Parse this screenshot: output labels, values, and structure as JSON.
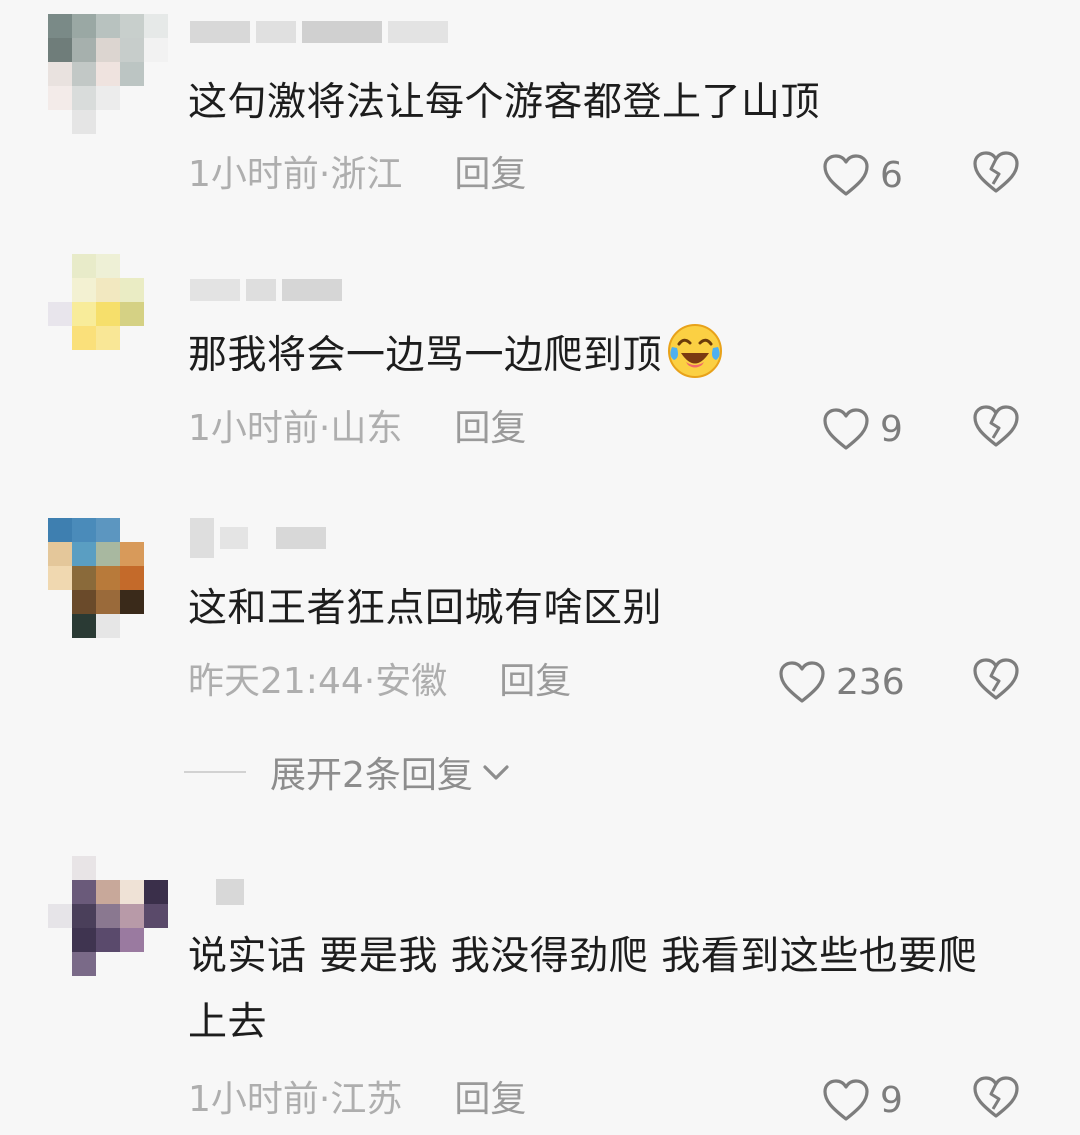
{
  "comments": [
    {
      "text": "这句激将法让每个游客都登上了山顶",
      "time": "1小时前",
      "location": "浙江",
      "reply_label": "回复",
      "likes": "6"
    },
    {
      "text": "那我将会一边骂一边爬到顶",
      "emoji": "crying-laughing-emoji",
      "time": "1小时前",
      "location": "山东",
      "reply_label": "回复",
      "likes": "9"
    },
    {
      "text": "这和王者狂点回城有啥区别",
      "time": "昨天21:44",
      "location": "安徽",
      "reply_label": "回复",
      "likes": "236"
    },
    {
      "text": "说实话 要是我 我没得劲爬 我看到这些也要爬上去",
      "time": "1小时前",
      "location": "江苏",
      "reply_label": "回复",
      "likes": "9"
    }
  ],
  "expand_replies_label": "展开2条回复",
  "meta_separator": " · ",
  "colors": {
    "background": "#f7f7f7",
    "text": "#1d1d1d",
    "meta": "#aeaeae"
  }
}
